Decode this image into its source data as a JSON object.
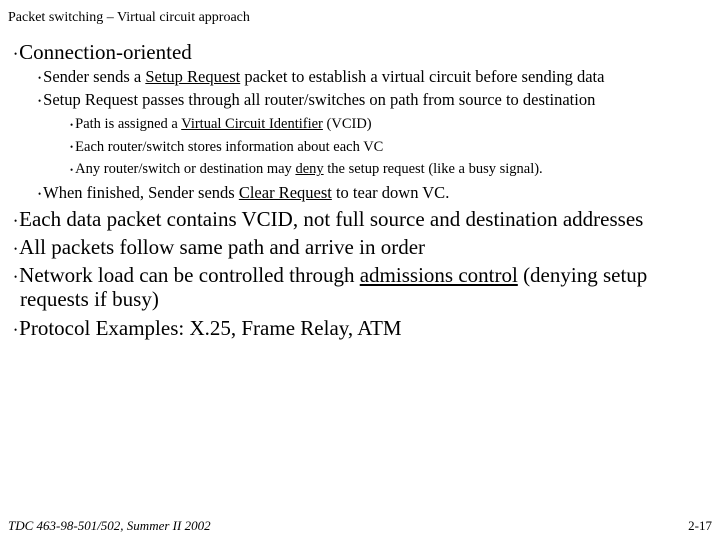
{
  "title": "Packet switching – Virtual circuit approach",
  "b1": "Connection-oriented",
  "b1a_pre": "Sender sends a ",
  "b1a_u": "Setup Request",
  "b1a_post": " packet to establish a virtual circuit before sending data",
  "b1b": "Setup Request passes through all router/switches on path from source to destination",
  "b1b1_pre": "Path is assigned a ",
  "b1b1_u": "Virtual Circuit Identifier",
  "b1b1_post": " (VCID)",
  "b1b2": "Each router/switch stores information about each VC",
  "b1b3_pre": "Any router/switch or destination may ",
  "b1b3_u": "deny",
  "b1b3_post": " the setup request (like a busy signal).",
  "b1c_pre": "When finished, Sender sends ",
  "b1c_u": "Clear Request",
  "b1c_post": " to tear down VC.",
  "b2": "Each data packet contains VCID, not full source and destination addresses",
  "b3": "All packets follow same path and arrive in order",
  "b4_pre": "Network load can be controlled through ",
  "b4_u": "admissions control",
  "b4_post": " (denying setup requests if busy)",
  "b5": "Protocol Examples: X.25, Frame Relay, ATM",
  "footer_left": "TDC 463-98-501/502, Summer II 2002",
  "footer_right": "2-17"
}
